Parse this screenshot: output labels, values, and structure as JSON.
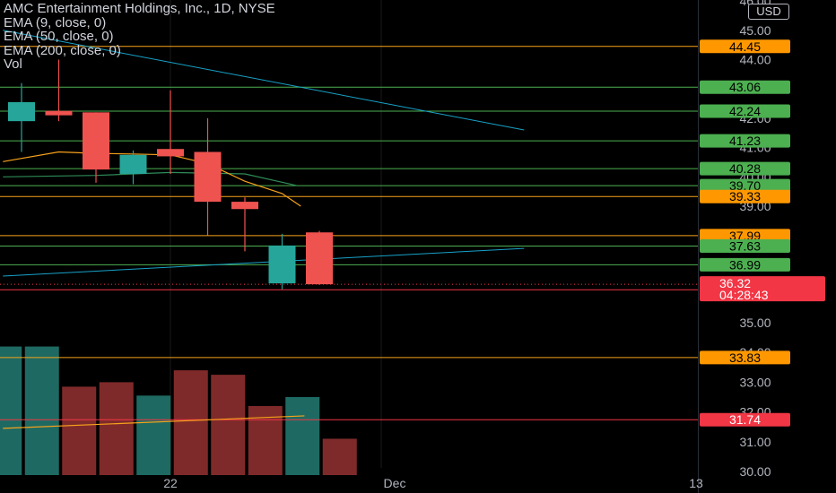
{
  "legend": {
    "title": "AMC Entertainment Holdings, Inc., 1D, NYSE",
    "ema9": "EMA (9, close, 0)",
    "ema50": "EMA (50, close, 0)",
    "ema200": "EMA (200, close, 0)",
    "vol": "Vol"
  },
  "currency": "USD",
  "colors": {
    "up": "#26a69a",
    "down": "#ef5350",
    "vol_up": "#1e6a62",
    "vol_down": "#7f2a2a",
    "ema9": "#f7a21b",
    "ema50": "#2e8b57",
    "ema200": "#17a2c8",
    "level_orange": "#f7a21b",
    "level_green": "#4caf50",
    "level_red": "#f23645",
    "axis_text": "#b2b5be",
    "label_orange": "#ff9800",
    "label_green": "#4caf50",
    "label_red": "#f23645"
  },
  "chart_data": {
    "type": "candlestick",
    "y_axis_ticks": [
      "46.00",
      "45.00",
      "44.00",
      "43.00",
      "42.00",
      "41.00",
      "40.00",
      "39.00",
      "35.00",
      "34.00",
      "33.00",
      "32.00",
      "31.00",
      "30.00"
    ],
    "x_axis_ticks": [
      "22",
      "Dec",
      "13"
    ],
    "ylim": [
      29.85,
      46.05
    ],
    "candles": [
      {
        "open": 41.9,
        "high": 43.2,
        "low": 40.85,
        "close": 42.55
      },
      {
        "open": 42.25,
        "high": 44.0,
        "low": 41.9,
        "close": 42.1
      },
      {
        "open": 42.2,
        "high": 42.2,
        "low": 39.8,
        "close": 40.25
      },
      {
        "open": 40.1,
        "high": 40.9,
        "low": 39.75,
        "close": 40.75
      },
      {
        "open": 40.95,
        "high": 42.95,
        "low": 40.1,
        "close": 40.7
      },
      {
        "open": 40.85,
        "high": 42.0,
        "low": 38.0,
        "close": 39.15
      },
      {
        "open": 39.15,
        "high": 39.3,
        "low": 37.45,
        "close": 38.9
      },
      {
        "open": 36.35,
        "high": 38.05,
        "low": 36.15,
        "close": 37.65
      },
      {
        "open": 38.1,
        "high": 38.15,
        "low": 36.3,
        "close": 36.32
      }
    ],
    "volume_bars": [
      {
        "value": 34.2,
        "dir": "up"
      },
      {
        "value": 34.2,
        "dir": "up"
      },
      {
        "value": 32.85,
        "dir": "down"
      },
      {
        "value": 33.0,
        "dir": "down"
      },
      {
        "value": 32.55,
        "dir": "up"
      },
      {
        "value": 33.4,
        "dir": "down"
      },
      {
        "value": 33.25,
        "dir": "down"
      },
      {
        "value": 32.2,
        "dir": "down"
      },
      {
        "value": 32.5,
        "dir": "up"
      },
      {
        "value": 31.1,
        "dir": "down"
      }
    ],
    "ema9_curve": [
      [
        -0.5,
        40.52
      ],
      [
        1,
        40.85
      ],
      [
        2,
        40.8
      ],
      [
        3,
        40.78
      ],
      [
        4,
        40.75
      ],
      [
        5,
        40.45
      ],
      [
        6,
        39.85
      ],
      [
        7,
        39.43
      ],
      [
        7.5,
        39.0
      ]
    ],
    "ema50_curve": [
      [
        -0.5,
        40.0
      ],
      [
        2,
        40.05
      ],
      [
        4,
        40.15
      ],
      [
        6,
        40.1
      ],
      [
        7.4,
        39.7
      ]
    ],
    "ema200_lines": [
      {
        "from": [
          -0.5,
          45.0
        ],
        "to": [
          13.5,
          41.6
        ]
      },
      {
        "from": [
          -0.5,
          36.6
        ],
        "to": [
          13.5,
          37.55
        ]
      }
    ],
    "volume_ma": {
      "from": [
        -0.5,
        31.45
      ],
      "to": [
        7.6,
        31.87
      ]
    },
    "levels": [
      {
        "label": "44.45",
        "price": 44.45,
        "style": "orange"
      },
      {
        "label": "43.06",
        "price": 43.06,
        "style": "green"
      },
      {
        "label": "42.24",
        "price": 42.24,
        "style": "green"
      },
      {
        "label": "41.23",
        "price": 41.23,
        "style": "green"
      },
      {
        "label": "40.28",
        "price": 40.28,
        "style": "green"
      },
      {
        "label": "39.70",
        "price": 39.7,
        "style": "green"
      },
      {
        "label": "39.33",
        "price": 39.33,
        "style": "orange"
      },
      {
        "label": "37.99",
        "price": 37.99,
        "style": "orange"
      },
      {
        "label": "37.63",
        "price": 37.63,
        "style": "green"
      },
      {
        "label": "36.99",
        "price": 36.99,
        "style": "green"
      },
      {
        "label": "36.13",
        "price": 36.13,
        "style": "red"
      },
      {
        "label": "33.83",
        "price": 33.83,
        "style": "orange"
      },
      {
        "label": "31.74",
        "price": 31.74,
        "style": "red"
      }
    ],
    "last_price": {
      "label": "36.32",
      "price": 36.32,
      "countdown": "04:28:43"
    }
  }
}
